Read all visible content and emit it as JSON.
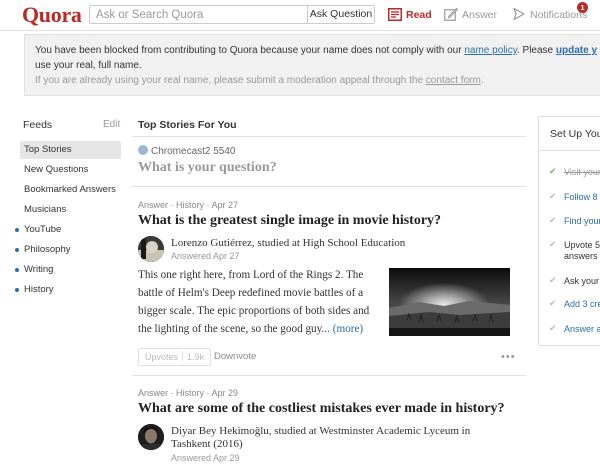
{
  "header": {
    "logo": "Quora",
    "search_placeholder": "Ask or Search Quora",
    "ask_button": "Ask Question",
    "nav": {
      "read": "Read",
      "answer": "Answer",
      "notifications": "Notifications",
      "notification_count": "1"
    },
    "colors": {
      "brand": "#b92b27",
      "link": "#2b6dad"
    }
  },
  "notice": {
    "line1_prefix": "You have been blocked from contributing to Quora because your name does not comply with our ",
    "policy_link": "name policy",
    "line1_mid": ". Please ",
    "update_link": "update y",
    "line2": "use your real, full name.",
    "line3_prefix": "If you are already using your real name, please submit a moderation appeal through the ",
    "contact_link": "contact form",
    "line3_suffix": "."
  },
  "sidebar": {
    "title": "Feeds",
    "edit": "Edit",
    "items": [
      {
        "label": "Top Stories",
        "active": true,
        "topic": false
      },
      {
        "label": "New Questions",
        "active": false,
        "topic": false
      },
      {
        "label": "Bookmarked Answers",
        "active": false,
        "topic": false
      },
      {
        "label": "Musicians",
        "active": false,
        "topic": false
      },
      {
        "label": "YouTube",
        "active": false,
        "topic": true
      },
      {
        "label": "Philosophy",
        "active": false,
        "topic": true
      },
      {
        "label": "Writing",
        "active": false,
        "topic": true
      },
      {
        "label": "History",
        "active": false,
        "topic": true
      }
    ]
  },
  "feed": {
    "title": "Top Stories For You",
    "asker": "Chromecast2 5540",
    "ask_prompt": "What is your question?",
    "stories": [
      {
        "meta": "Answer · History · Apr 27",
        "question": "What is the greatest single image in movie history?",
        "author": "Lorenzo Gutiérrez, studied at High School Education",
        "answered": "Answered Apr 27",
        "excerpt": "This one right here, from Lord of the Rings 2. The battle of Helm's Deep redefined movie battles of a bigger scale. The epic proportions of both sides and the lighting of the scene, so the good guy... ",
        "more": "(more)",
        "upvotes_label": "Upvotes",
        "upvotes_count": "1.9k",
        "downvote": "Downvote",
        "more_dots": "•••"
      },
      {
        "meta": "Answer · History · Apr 29",
        "question": "What are some of the costliest mistakes ever made in history?",
        "author_line1": "Diyar Bey Hekimoğlu, studied at Westminster Academic Lyceum in",
        "author_line2": "Tashkent (2016)",
        "answered": "Answered Apr 29"
      }
    ]
  },
  "setup": {
    "title": "Set Up You",
    "items": [
      {
        "label": "Visit your",
        "state": "done"
      },
      {
        "label": "Follow 8 n",
        "state": "link"
      },
      {
        "label": "Find your",
        "state": "link"
      },
      {
        "label_line1": "Upvote 5",
        "label_line2": "answers",
        "state": "text"
      },
      {
        "label": "Ask your",
        "state": "text"
      },
      {
        "label": "Add 3 cre",
        "state": "link"
      },
      {
        "label": "Answer a",
        "state": "link"
      }
    ]
  }
}
